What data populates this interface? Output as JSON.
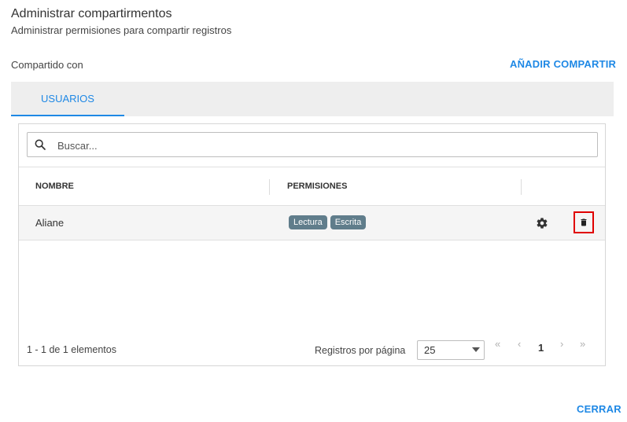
{
  "dialog": {
    "title": "Administrar compartirmentos",
    "subtitle": "Administrar permisiones para compartir registros",
    "shared_with_label": "Compartido con",
    "add_share_label": "AÑADIR COMPARTIR",
    "close_label": "CERRAR"
  },
  "tabs": [
    {
      "label": "USUARIOS",
      "active": true
    }
  ],
  "search": {
    "placeholder": "Buscar...",
    "value": ""
  },
  "table": {
    "columns": [
      "NOMBRE",
      "PERMISIONES"
    ],
    "rows": [
      {
        "name": "Aliane",
        "permissions": [
          "Lectura",
          "Escrita"
        ]
      }
    ]
  },
  "footer": {
    "range_text": "1 - 1 de 1 elementos",
    "per_page_label": "Registros por página",
    "per_page_value": "25",
    "current_page": "1",
    "first_icon": "«",
    "prev_icon": "‹",
    "next_icon": "›",
    "last_icon": "»"
  },
  "colors": {
    "accent": "#1e88e5",
    "chip": "#607d8b",
    "highlight_box": "#e00000",
    "row_bg": "#f5f5f5",
    "tabbar_bg": "#eeeeee"
  },
  "icons": {
    "search": "search-icon",
    "settings": "gear-icon",
    "delete": "trash-icon"
  }
}
